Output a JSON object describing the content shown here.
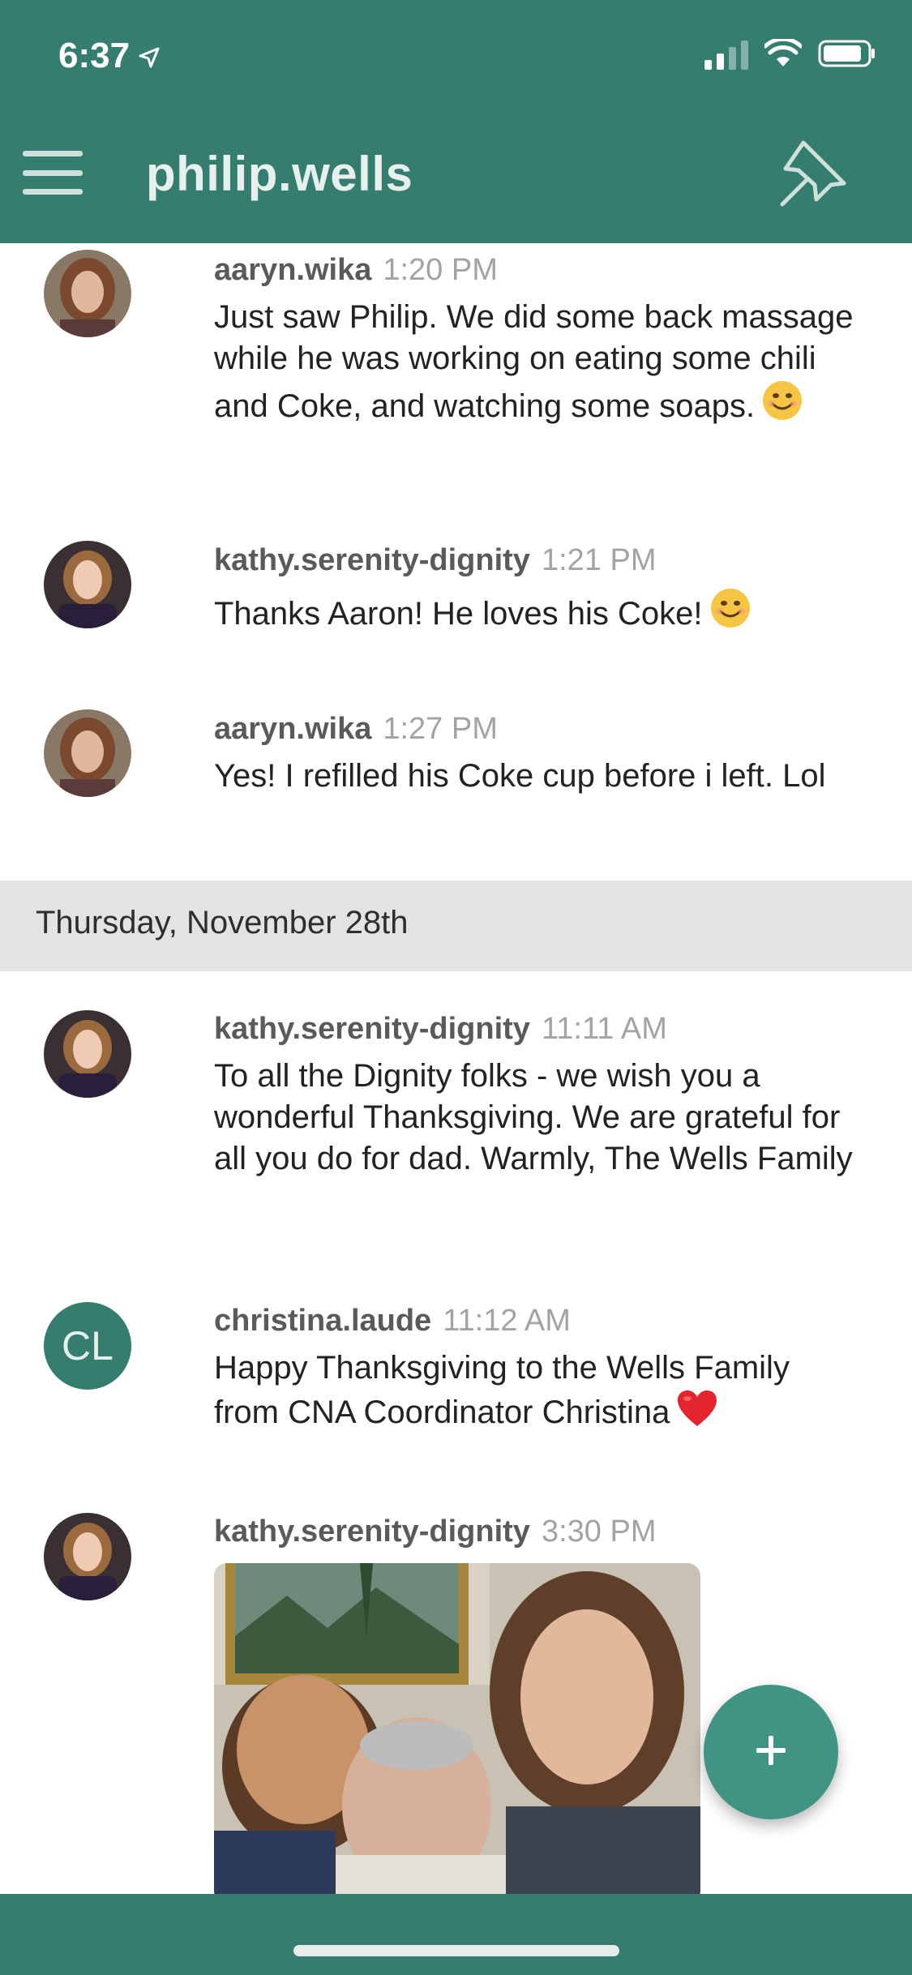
{
  "status_bar": {
    "time": "6:37",
    "location_icon": "location-arrow-icon",
    "signal_icon": "cellular-signal-icon",
    "wifi_icon": "wifi-icon",
    "battery_icon": "battery-icon"
  },
  "nav": {
    "title": "philip.wells",
    "menu_icon": "hamburger-menu-icon",
    "pin_icon": "pin-icon"
  },
  "messages": [
    {
      "user": "aaryn.wika",
      "time": "1:20 PM",
      "text": "Just saw Philip. We did some back massage while he was working on eating some chili and Coke, and watching some soaps.",
      "emoji": "😊"
    },
    {
      "user": "kathy.serenity-dignity",
      "time": "1:21 PM",
      "text": "Thanks Aaron! He loves his Coke!",
      "emoji": "😊"
    },
    {
      "user": "aaryn.wika",
      "time": "1:27 PM",
      "text": "Yes! I refilled his Coke cup before i left. Lol",
      "emoji": ""
    },
    {
      "user": "kathy.serenity-dignity",
      "time": "11:11 AM",
      "text": "To all the Dignity folks - we wish you a wonderful Thanksgiving. We are grateful for all you do for dad. Warmly, The Wells Family",
      "emoji": ""
    },
    {
      "user": "christina.laude",
      "time": "11:12 AM",
      "text": "Happy Thanksgiving to the Wells Family from CNA Coordinator Christina",
      "emoji": "❤️",
      "avatar_initials": "CL"
    },
    {
      "user": "kathy.serenity-dignity",
      "time": "3:30 PM",
      "text": "",
      "emoji": ""
    }
  ],
  "date_separator": "Thursday, November 28th",
  "fab": {
    "icon": "plus-icon"
  },
  "colors": {
    "brand": "#357d6f",
    "fab": "#3f9484",
    "date_band": "#e3e3e3"
  }
}
